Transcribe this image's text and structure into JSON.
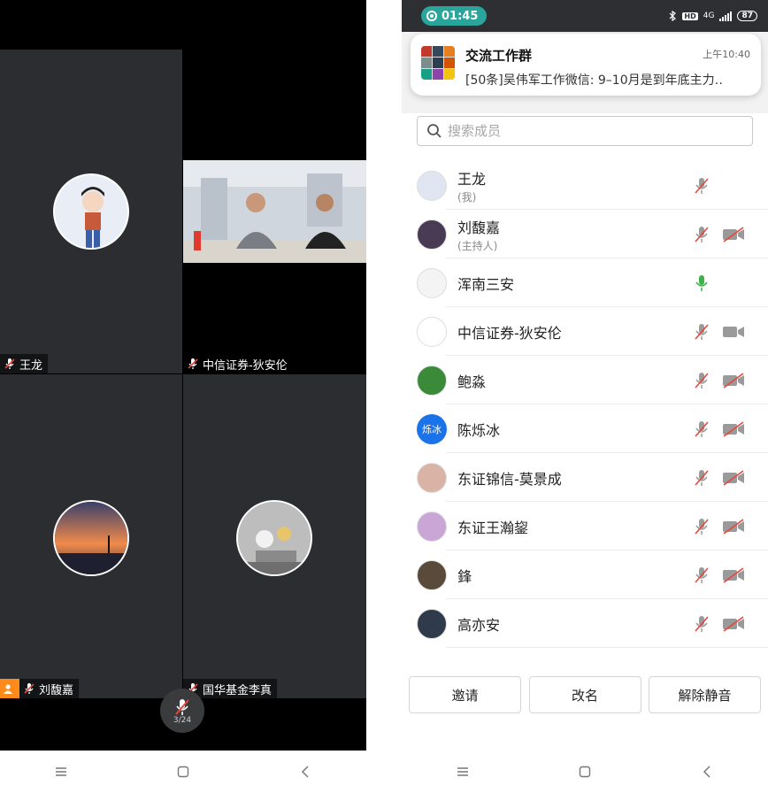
{
  "video_grid": {
    "tiles": [
      {
        "name": "王龙"
      },
      {
        "name": "中信证券-狄安伦"
      },
      {
        "name": "刘馥嘉"
      },
      {
        "name": "国华基金李真"
      }
    ],
    "mute_button_label": "3/24"
  },
  "status_bar": {
    "timer": "01:45",
    "network": "4G",
    "battery": "87"
  },
  "notification": {
    "title": "交流工作群",
    "time": "上午10:40",
    "text": "[50条]吴伟军工作微信: 9–10月是到年底主力‥"
  },
  "search": {
    "placeholder": "搜索成员"
  },
  "participants": [
    {
      "name": "王龙",
      "sub": "(我)",
      "mic": "muted",
      "video": "none"
    },
    {
      "name": "刘馥嘉",
      "sub": "(主持人)",
      "mic": "muted",
      "video": "off"
    },
    {
      "name": "浑南三安",
      "sub": "",
      "mic": "active",
      "video": "none"
    },
    {
      "name": "中信证券-狄安伦",
      "sub": "",
      "mic": "muted",
      "video": "on"
    },
    {
      "name": "鲍淼",
      "sub": "",
      "mic": "muted",
      "video": "off"
    },
    {
      "name": "陈烁冰",
      "sub": "",
      "mic": "muted",
      "video": "off",
      "avatar_text": "烁冰"
    },
    {
      "name": "东证锦信-莫景成",
      "sub": "",
      "mic": "muted",
      "video": "off"
    },
    {
      "name": "东证王瀚鋆",
      "sub": "",
      "mic": "muted",
      "video": "off"
    },
    {
      "name": "鋒",
      "sub": "",
      "mic": "muted",
      "video": "off"
    },
    {
      "name": "高亦安",
      "sub": "",
      "mic": "muted",
      "video": "off"
    }
  ],
  "actions": {
    "invite": "邀请",
    "rename": "改名",
    "unmute_all": "解除静音"
  },
  "colors": {
    "accent": "#2aa59b",
    "muted_red": "#e8463c",
    "mic_active": "#3fb14a",
    "host_badge": "#ff8a1c"
  }
}
